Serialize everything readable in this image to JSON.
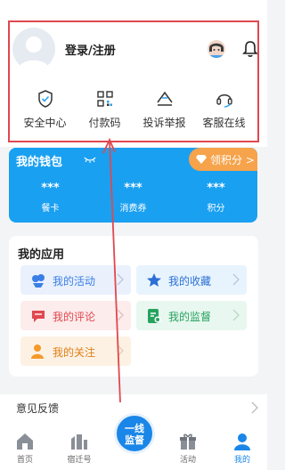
{
  "profile": {
    "login_label": "登录/注册"
  },
  "quick_actions": [
    {
      "label": "安全中心",
      "icon": "shield-check-icon"
    },
    {
      "label": "付款码",
      "icon": "qr-code-icon"
    },
    {
      "label": "投诉举报",
      "icon": "complaint-icon"
    },
    {
      "label": "客服在线",
      "icon": "headset-icon"
    }
  ],
  "wallet": {
    "title": "我的钱包",
    "points_button": "领积分 >",
    "items": [
      {
        "value": "***",
        "label": "餐卡"
      },
      {
        "value": "***",
        "label": "消费券"
      },
      {
        "value": "***",
        "label": "积分"
      }
    ]
  },
  "apps": {
    "title": "我的应用",
    "items": [
      {
        "label": "我的活动",
        "icon": "activity-icon"
      },
      {
        "label": "我的收藏",
        "icon": "star-icon"
      },
      {
        "label": "我的评论",
        "icon": "comment-icon"
      },
      {
        "label": "我的监督",
        "icon": "supervise-icon"
      },
      {
        "label": "我的关注",
        "icon": "follow-icon"
      }
    ]
  },
  "feedback": {
    "label": "意见反馈"
  },
  "tabbar": {
    "items": [
      {
        "label": "首页",
        "icon": "home-icon"
      },
      {
        "label": "宿迁号",
        "icon": "city-icon"
      },
      {
        "label": "活动",
        "icon": "gift-icon"
      },
      {
        "label": "我的",
        "icon": "user-icon"
      }
    ],
    "center_line1": "一线",
    "center_line2": "监督"
  },
  "colors": {
    "accent": "#1a86e8",
    "wallet": "#1aa0f1",
    "points": "#f6a34b",
    "highlight": "#e0484f"
  }
}
